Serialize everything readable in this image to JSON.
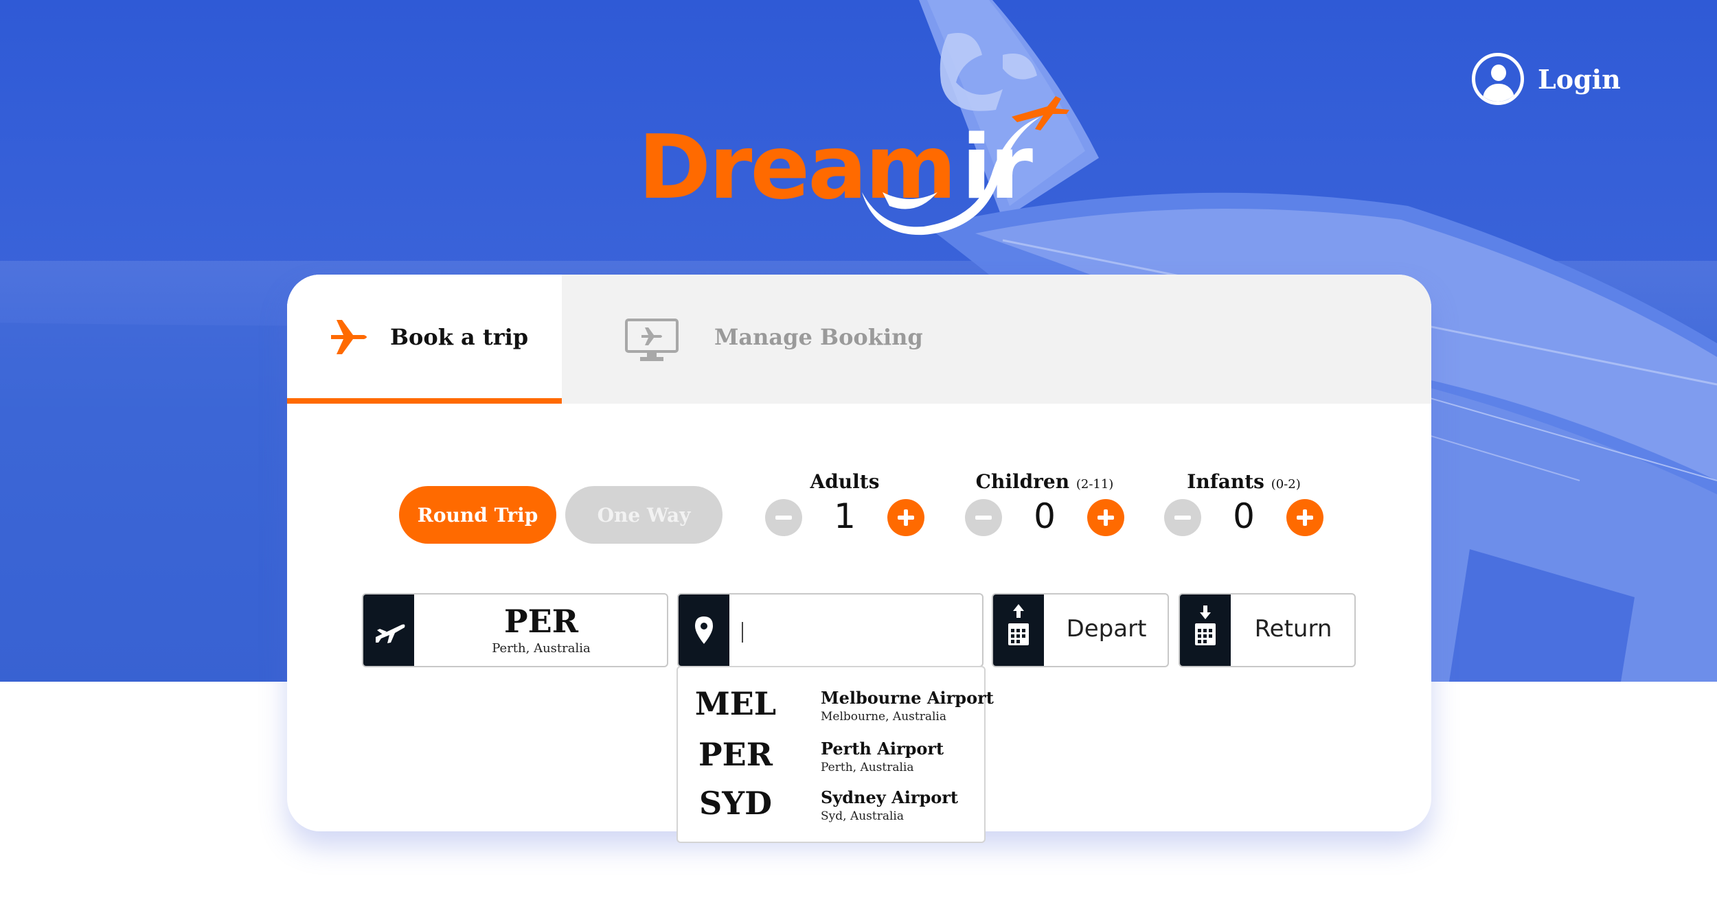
{
  "brand": {
    "logo_text_orange": "Dream",
    "logo_text_white": "ir",
    "logo_icon": "airplane-swoosh-icon",
    "accent": "#ff6a00",
    "hero_blue": "#3a63d9"
  },
  "header": {
    "login_label": "Login",
    "login_icon": "user-circle-icon"
  },
  "tabs": [
    {
      "label": "Book a trip",
      "icon": "airplane-icon",
      "active": true
    },
    {
      "label": "Manage Booking",
      "icon": "monitor-plane-icon",
      "active": false
    }
  ],
  "trip_type": {
    "options": [
      "Round Trip",
      "One Way"
    ],
    "selected": "Round Trip"
  },
  "passengers": {
    "adults": {
      "label": "Adults",
      "sub": "",
      "count": "1"
    },
    "children": {
      "label": "Children",
      "sub": "(2-11)",
      "count": "0"
    },
    "infants": {
      "label": "Infants",
      "sub": "(0-2)",
      "count": "0"
    }
  },
  "search": {
    "from": {
      "code": "PER",
      "city": "Perth, Australia",
      "icon": "plane-takeoff-icon"
    },
    "to": {
      "value": "",
      "placeholder": "",
      "icon": "map-pin-icon"
    },
    "depart": {
      "label": "Depart",
      "icon": "calendar-depart-icon"
    },
    "return": {
      "label": "Return",
      "icon": "calendar-return-icon"
    }
  },
  "suggestions": [
    {
      "code": "MEL",
      "name": "Melbourne Airport",
      "location": "Melbourne, Australia"
    },
    {
      "code": "PER",
      "name": "Perth Airport",
      "location": "Perth, Australia"
    },
    {
      "code": "SYD",
      "name": "Sydney Airport",
      "location": "Syd, Australia"
    }
  ]
}
